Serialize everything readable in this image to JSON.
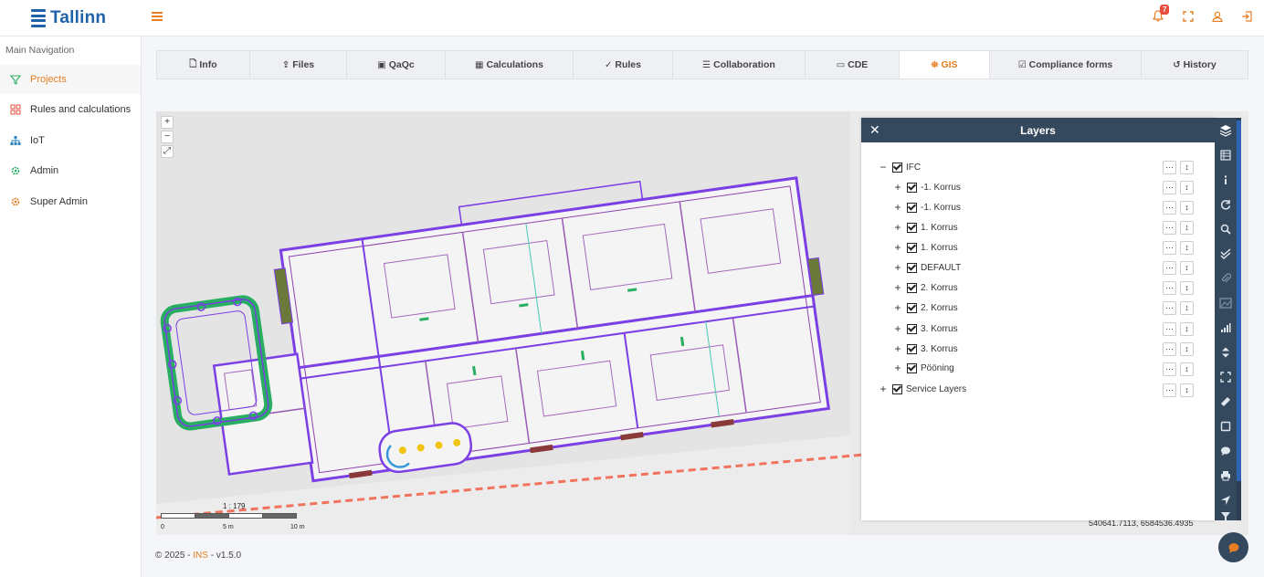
{
  "app": {
    "brand": "Tallinn",
    "notification_count": "7"
  },
  "sidebar": {
    "title": "Main Navigation",
    "items": [
      {
        "label": "Projects",
        "icon": "filter-icon",
        "active": true
      },
      {
        "label": "Rules and calculations",
        "icon": "grid-icon",
        "active": false
      },
      {
        "label": "IoT",
        "icon": "sitemap-icon",
        "active": false
      },
      {
        "label": "Admin",
        "icon": "gear-icon",
        "active": false
      },
      {
        "label": "Super Admin",
        "icon": "gear-icon",
        "active": false
      }
    ]
  },
  "tabs": [
    {
      "label": "Info",
      "icon": "file-icon"
    },
    {
      "label": "Files",
      "icon": "upload-icon"
    },
    {
      "label": "QaQc",
      "icon": "calendar-check-icon"
    },
    {
      "label": "Calculations",
      "icon": "calculator-icon"
    },
    {
      "label": "Rules",
      "icon": "check-icon"
    },
    {
      "label": "Collaboration",
      "icon": "list-check-icon"
    },
    {
      "label": "CDE",
      "icon": "folder-open-icon"
    },
    {
      "label": "GIS",
      "icon": "map-icon",
      "active": true
    },
    {
      "label": "Compliance forms",
      "icon": "check-square-icon"
    },
    {
      "label": "History",
      "icon": "history-icon"
    }
  ],
  "map": {
    "zoom_in": "+",
    "zoom_out": "−",
    "fullscreen": "⤢",
    "scale": {
      "label": "1 : 179",
      "ticks": [
        "0",
        "5 m",
        "10 m"
      ]
    },
    "coordinates": "540641.7113, 6584536.4935"
  },
  "layers_panel": {
    "title": "Layers",
    "close": "✕",
    "root": {
      "label": "IFC",
      "expander": "−"
    },
    "children": [
      {
        "label": "-1. Korrus"
      },
      {
        "label": "-1. Korrus"
      },
      {
        "label": "1. Korrus"
      },
      {
        "label": "1. Korrus"
      },
      {
        "label": "DEFAULT"
      },
      {
        "label": "2. Korrus"
      },
      {
        "label": "2. Korrus"
      },
      {
        "label": "3. Korrus"
      },
      {
        "label": "3. Korrus"
      },
      {
        "label": "Pööning"
      }
    ],
    "service": {
      "label": "Service Layers",
      "expander": "+"
    },
    "child_expander": "+",
    "menu_button": "···",
    "reorder_button": "↕"
  },
  "toolbar": {
    "tools": [
      "layers-icon",
      "table-icon",
      "info-icon",
      "refresh-icon",
      "search-icon",
      "check-double-icon",
      "paperclip-icon",
      "image-icon",
      "signal-icon",
      "arrows-v-icon",
      "expand-icon",
      "ruler-icon",
      "square-icon",
      "comment-icon",
      "print-icon",
      "location-arrow-icon",
      "filter-icon"
    ]
  },
  "footer": {
    "prefix": "© 2025 - ",
    "brand": "INS",
    "version": " - v1.5.0"
  },
  "colors": {
    "accent": "#e67e22",
    "panel": "#34495e",
    "brand": "#1f62a8",
    "plan": "#7b3fe4"
  }
}
